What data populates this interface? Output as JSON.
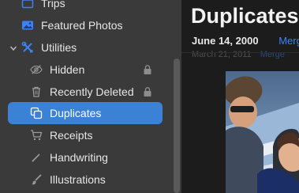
{
  "sidebar": {
    "items": [
      {
        "label": "Trips",
        "icon": "suitcase-icon",
        "indent": 1
      },
      {
        "label": "Featured Photos",
        "icon": "photo-icon",
        "indent": 1
      },
      {
        "label": "Utilities",
        "icon": "tools-icon",
        "indent": 1,
        "expanded": true
      },
      {
        "label": "Hidden",
        "icon": "eye-slash-icon",
        "indent": 2,
        "locked": true
      },
      {
        "label": "Recently Deleted",
        "icon": "trash-icon",
        "indent": 2,
        "locked": true
      },
      {
        "label": "Duplicates",
        "icon": "duplicate-icon",
        "indent": 2,
        "selected": true
      },
      {
        "label": "Receipts",
        "icon": "cart-icon",
        "indent": 2
      },
      {
        "label": "Handwriting",
        "icon": "pencil-icon",
        "indent": 2
      },
      {
        "label": "Illustrations",
        "icon": "brush-icon",
        "indent": 2
      }
    ]
  },
  "main": {
    "title": "Duplicates",
    "groups": [
      {
        "date": "June 14, 2000",
        "action": "Merge"
      },
      {
        "date": "March 21, 2011",
        "action": "Merge"
      }
    ]
  },
  "colors": {
    "accent": "#3b82f6",
    "selection": "#3b82d6",
    "sidebar_bg": "#3a3a3a",
    "main_bg": "#1c1c1c"
  }
}
